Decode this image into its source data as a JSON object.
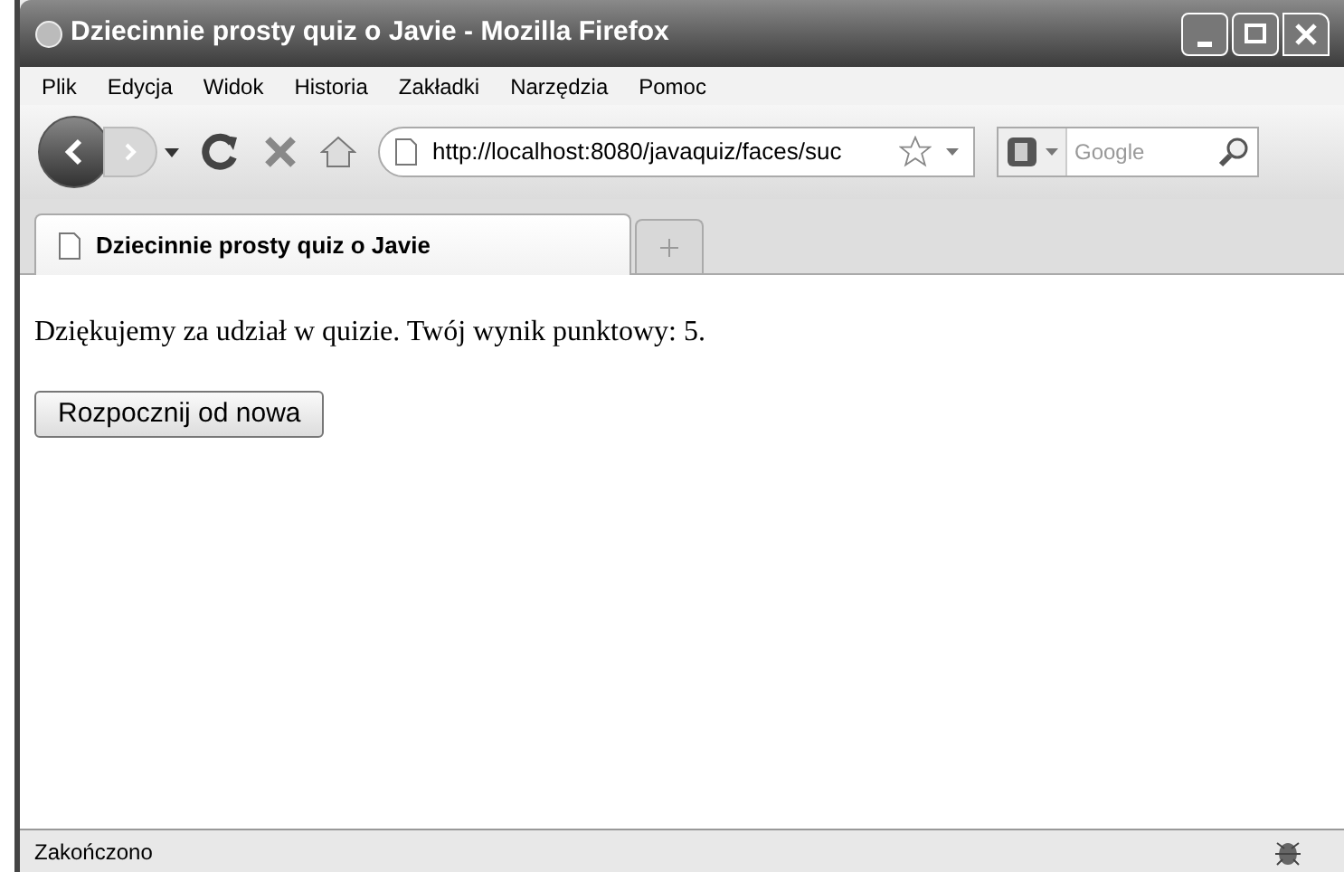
{
  "window": {
    "title": "Dziecinnie prosty quiz o Javie - Mozilla Firefox"
  },
  "menu": [
    "Plik",
    "Edycja",
    "Widok",
    "Historia",
    "Zakładki",
    "Narzędzia",
    "Pomoc"
  ],
  "address": {
    "value": "http://localhost:8080/javaquiz/faces/suc"
  },
  "search": {
    "placeholder": "Google"
  },
  "tabs": [
    {
      "label": "Dziecinnie prosty quiz o Javie",
      "selected": true
    }
  ],
  "content": {
    "message": "Dziękujemy za udział w quizie. Twój wynik punktowy: 5.",
    "button": "Rozpocznij od nowa"
  },
  "status_bar": "Zakończono"
}
